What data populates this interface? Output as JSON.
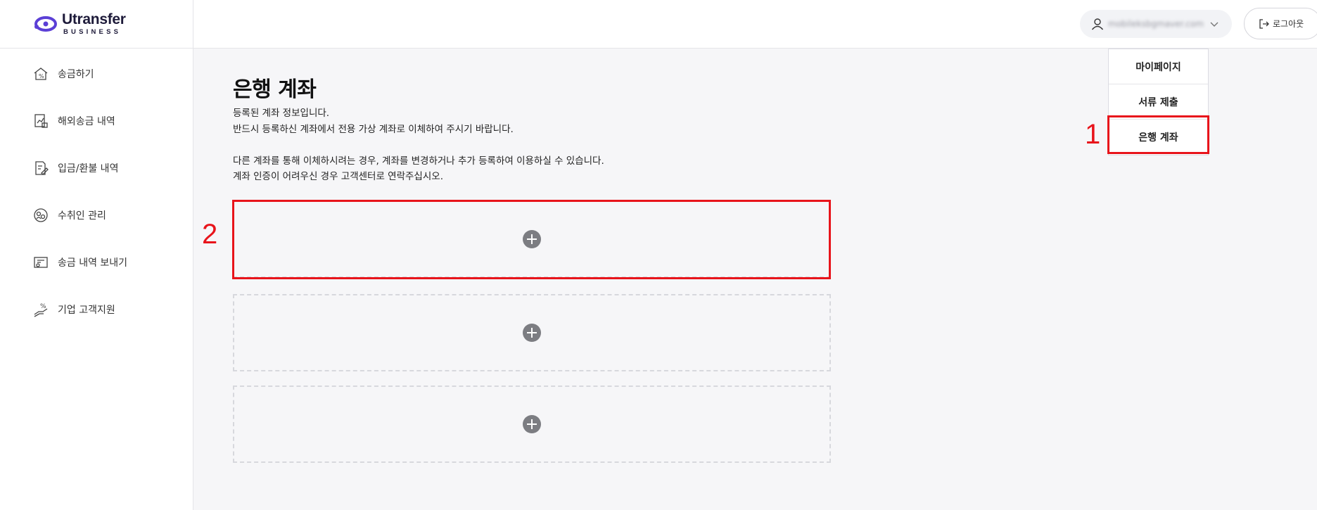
{
  "app": {
    "logo_name": "Utransfer",
    "logo_sub": "BUSINESS",
    "brand_color": "#5b3fd6"
  },
  "sidebar": {
    "items": [
      {
        "label": "송금하기",
        "icon": "house-money-icon"
      },
      {
        "label": "해외송금 내역",
        "icon": "chart-document-icon"
      },
      {
        "label": "입금/환불 내역",
        "icon": "document-pen-icon"
      },
      {
        "label": "수취인 관리",
        "icon": "people-cycle-icon"
      },
      {
        "label": "송금 내역 보내기",
        "icon": "certificate-icon"
      },
      {
        "label": "기업 고객지원",
        "icon": "hand-percent-icon"
      }
    ]
  },
  "header": {
    "user_email": "mobileksbgmaver.com",
    "logout_label": "로그아웃"
  },
  "dropdown": {
    "items": [
      {
        "label": "마이페이지"
      },
      {
        "label": "서류 제출"
      },
      {
        "label": "은행 계좌"
      }
    ]
  },
  "main": {
    "title": "은행 계좌",
    "desc_lines": [
      "등록된 계좌 정보입니다.",
      "반드시 등록하신 계좌에서 전용 가상 계좌로 이체하여 주시기 바랍니다.",
      "",
      "다른 계좌를 통해 이체하시려는 경우, 계좌를 변경하거나 추가 등록하여 이용하실 수 있습니다.",
      "계좌 인증이 어려우신 경우 고객센터로 연락주십시오."
    ],
    "account_slots": 3
  },
  "annotations": {
    "label_1": "1",
    "label_2": "2",
    "highlight_color": "#e8141b"
  }
}
